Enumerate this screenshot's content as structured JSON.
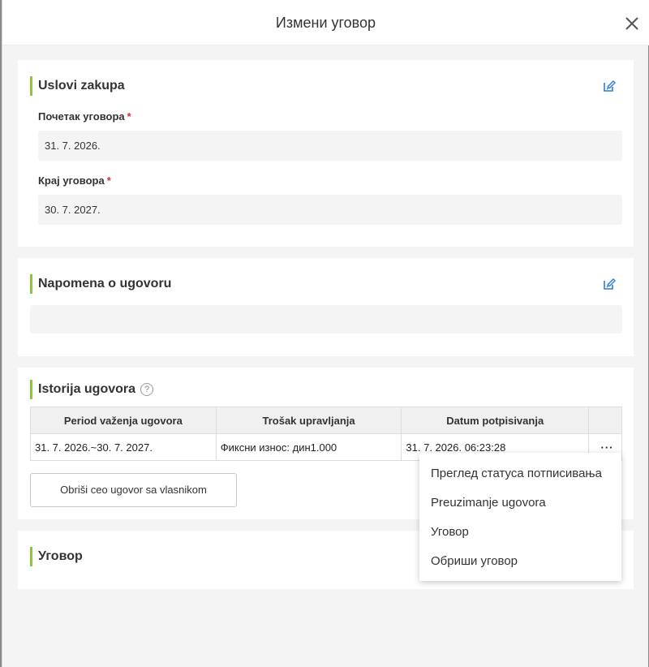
{
  "modal": {
    "title": "Измени уговор"
  },
  "lease_terms": {
    "title": "Uslovi zakupa",
    "start_label": "Почетак уговора",
    "start_value": "31. 7. 2026.",
    "end_label": "Крај уговора",
    "end_value": "30. 7. 2027.",
    "required_mark": "*"
  },
  "note": {
    "title": "Napomena o ugovoru",
    "value": ""
  },
  "history": {
    "title": "Istorija ugovora",
    "help_glyph": "?",
    "columns": [
      "Period važenja ugovora",
      "Trošak upravljanja",
      "Datum potpisivanja"
    ],
    "rows": [
      {
        "period": "31. 7. 2026.~30. 7. 2027.",
        "cost": "Фиксни износ: дин1.000",
        "signed": "31. 7. 2026. 06:23:28",
        "more": "···"
      }
    ],
    "delete_all_label": "Obriši ceo ugovor sa vlasnikom"
  },
  "contract": {
    "title": "Уговор"
  },
  "dropdown": {
    "items": [
      "Преглед статуса потписивања",
      "Preuzimanje ugovora",
      "Уговор",
      "Обриши уговор"
    ]
  },
  "icons": {
    "close": "close-icon",
    "edit": "edit-icon",
    "help": "help-icon"
  },
  "colors": {
    "accent": "#8cc63f",
    "edit_icon": "#2f7bd8",
    "required": "#d42f2f"
  }
}
